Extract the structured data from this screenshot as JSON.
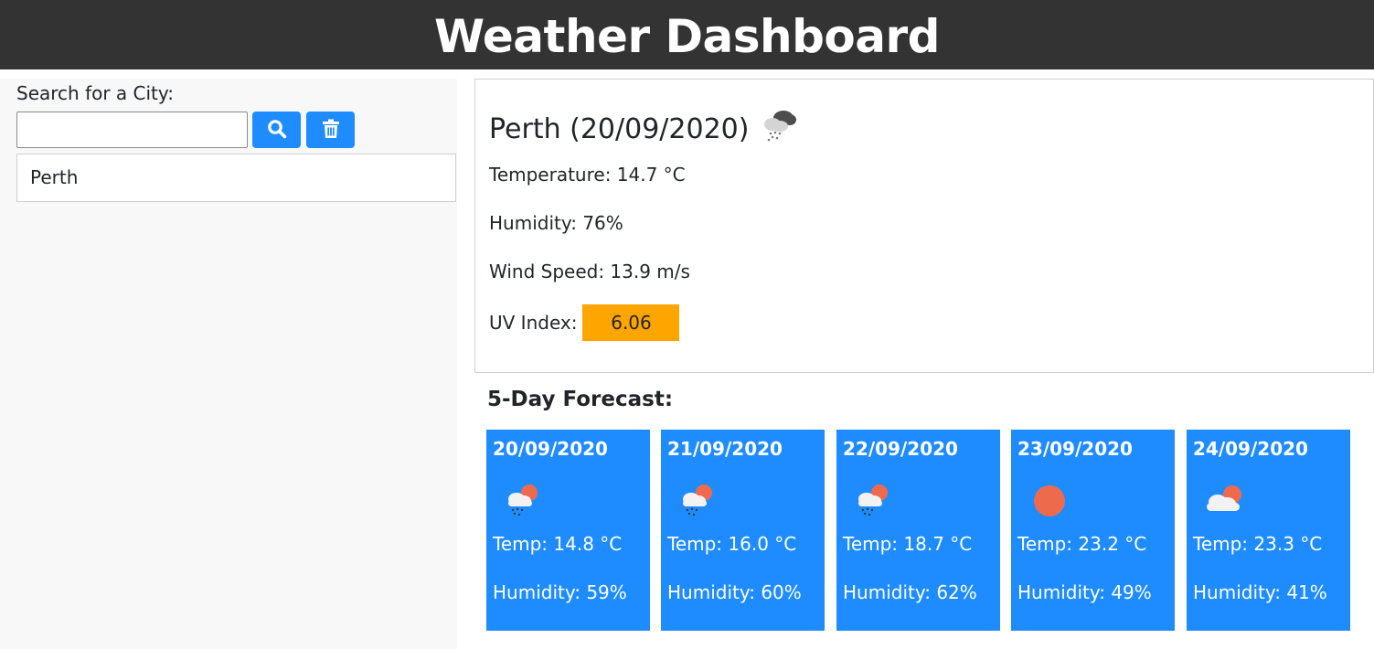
{
  "header": {
    "title": "Weather Dashboard"
  },
  "sidebar": {
    "search_label": "Search for a City:",
    "search_value": "",
    "search_button_icon": "search-icon",
    "clear_button_icon": "trash-icon",
    "history": [
      {
        "city": "Perth"
      }
    ]
  },
  "current": {
    "title": "Perth (20/09/2020)",
    "icon": "rain-cloud-icon",
    "temperature": "Temperature: 14.7 °C",
    "humidity": "Humidity: 76%",
    "wind": "Wind Speed: 13.9 m/s",
    "uv_label": "UV Index:",
    "uv_value": "6.06",
    "uv_color": "#ffa500"
  },
  "forecast": {
    "title": "5-Day Forecast:",
    "days": [
      {
        "date": "20/09/2020",
        "icon": "sun-rain-cloud-icon",
        "temp": "Temp: 14.8 °C",
        "humidity": "Humidity: 59%"
      },
      {
        "date": "21/09/2020",
        "icon": "sun-rain-cloud-icon",
        "temp": "Temp: 16.0 °C",
        "humidity": "Humidity: 60%"
      },
      {
        "date": "22/09/2020",
        "icon": "sun-rain-cloud-icon",
        "temp": "Temp: 18.7 °C",
        "humidity": "Humidity: 62%"
      },
      {
        "date": "23/09/2020",
        "icon": "sun-icon",
        "temp": "Temp: 23.2 °C",
        "humidity": "Humidity: 49%"
      },
      {
        "date": "24/09/2020",
        "icon": "sun-cloud-icon",
        "temp": "Temp: 23.3 °C",
        "humidity": "Humidity: 41%"
      }
    ]
  },
  "colors": {
    "header_bg": "#333333",
    "accent": "#1e8cff",
    "uv_moderate": "#ffa500",
    "sun": "#ee6a4d"
  }
}
